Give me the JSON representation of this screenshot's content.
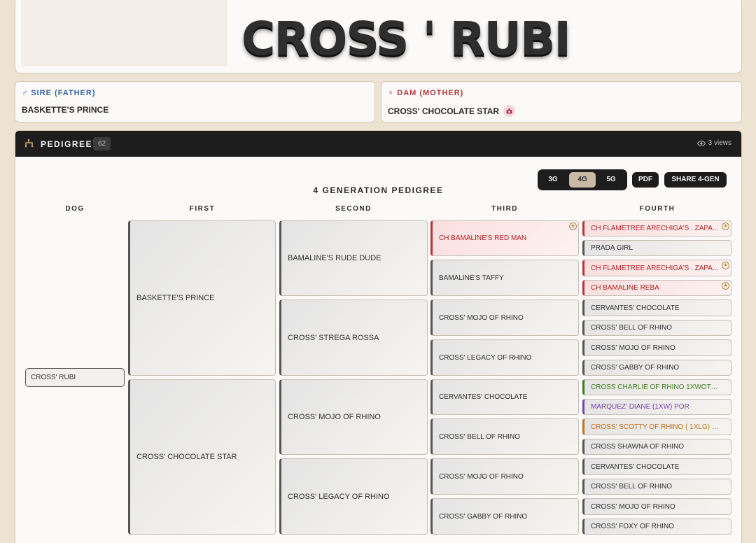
{
  "dog": {
    "name": "CROSS ' RUBI"
  },
  "sire": {
    "label": "SIRE (FATHER)",
    "symbol": "♂",
    "name": "BASKETTE'S PRINCE"
  },
  "dam": {
    "label": "DAM (MOTHER)",
    "symbol": "♀",
    "name": "CROSS' CHOCOLATE STAR"
  },
  "pedigree": {
    "title": "PEDIGREE",
    "count": "62",
    "views": "3 views",
    "heading": "4 GENERATION PEDIGREE",
    "generation_options": [
      "3G",
      "4G",
      "5G"
    ],
    "selected_generation": "4G",
    "pdf_label": "PDF",
    "share_label": "SHARE 4-GEN",
    "columns": [
      "DOG",
      "FIRST",
      "SECOND",
      "THIRD",
      "FOURTH"
    ],
    "subject": "CROSS' RUBI",
    "first": [
      "BASKETTE'S PRINCE",
      "CROSS' CHOCOLATE STAR"
    ],
    "second": [
      "BAMALINE'S RUDE DUDE",
      "CROSS' STREGA ROSSA",
      "CROSS' MOJO OF RHINO",
      "CROSS' LEGACY OF RHINO"
    ],
    "third": [
      "CH BAMALINE'S RED MAN",
      "BAMALINE'S TAFFY",
      "CROSS' MOJO OF RHINO",
      "CROSS' LEGACY OF RHINO",
      "CERVANTES' CHOCOLATE",
      "CROSS' BELL OF RHINO",
      "CROSS' MOJO OF RHINO",
      "CROSS' GABBY OF RHINO"
    ],
    "fourth": [
      "CH FLAMETREE ARECHIGA'S . ZAPATA ...",
      "PRADA GIRL",
      "CH FLAMETREE ARECHIGA'S . ZAPATA ...",
      "CH BAMALINE REBA",
      "CERVANTES' CHOCOLATE",
      "CROSS' BELL OF RHINO",
      "CROSS' MOJO OF RHINO",
      "CROSS' GABBY OF RHINO",
      "CROSS CHARLIE OF RHINO 1XWOTC 1XL...",
      "MARQUEZ' DIANE (1XW) POR",
      "CROSS' SCOTTY OF RHINO ( 1XLG) (2X...",
      "CROSS SHAWNA OF RHINO",
      "CERVANTES' CHOCOLATE",
      "CROSS' BELL OF RHINO",
      "CROSS' MOJO OF RHINO",
      "CROSS' FOXY OF RHINO"
    ],
    "colors": {
      "champion": "#b22222",
      "green": "#3f7f1f",
      "purple": "#7b3fb0",
      "orange": "#c8701c"
    }
  },
  "icons": {
    "sire": "male-icon",
    "dam": "female-icon",
    "camera": "camera-icon",
    "pedigree": "pedigree-icon",
    "views": "eye-icon",
    "badge": "star-badge-icon"
  }
}
